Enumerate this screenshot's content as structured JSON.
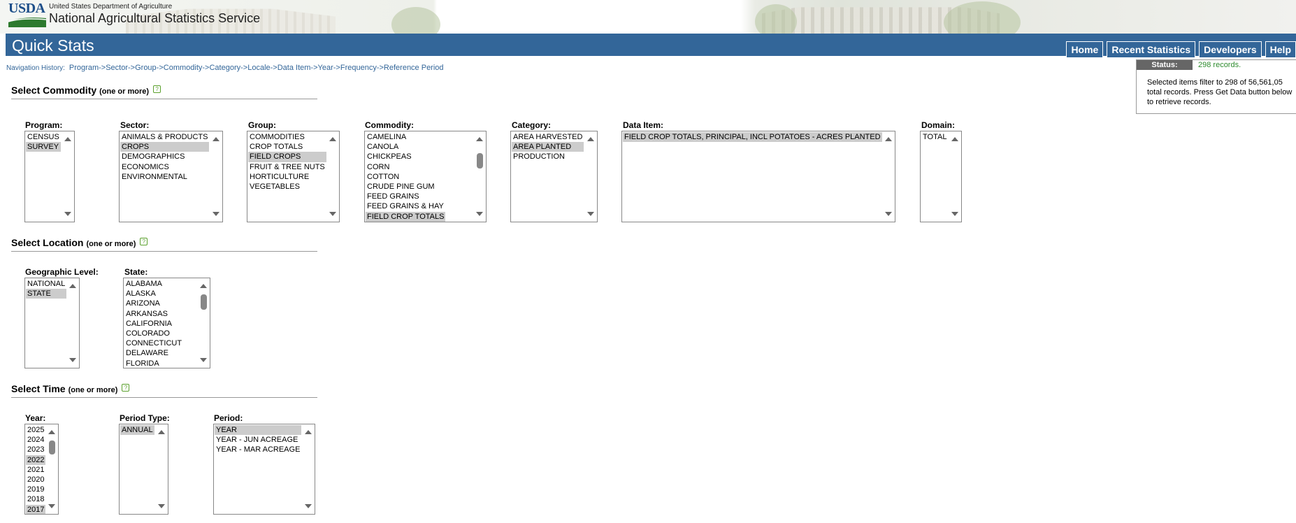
{
  "header": {
    "logo_text": "USDA",
    "department": "United States Department of Agriculture",
    "agency": "National Agricultural Statistics Service"
  },
  "titlebar": {
    "title": "Quick Stats",
    "nav": [
      "Home",
      "Recent Statistics",
      "Developers",
      "Help"
    ]
  },
  "status": {
    "label": "Status:",
    "count": "298 records.",
    "message": "Selected items filter to 298 of 56,561,05 total records. Press Get Data button below to retrieve records."
  },
  "nav_history": {
    "label": "Navigation History:",
    "steps": [
      "Program",
      "Sector",
      "Group",
      "Commodity",
      "Category",
      "Locale",
      "Data Item",
      "Year",
      "Frequency",
      "Reference Period"
    ],
    "separator": "->"
  },
  "commodity_section": {
    "title": "Select Commodity",
    "subtitle": "(one or more)",
    "program": {
      "label": "Program:",
      "options": [
        "CENSUS",
        "SURVEY"
      ],
      "selected": [
        "SURVEY"
      ]
    },
    "sector": {
      "label": "Sector:",
      "options": [
        "ANIMALS & PRODUCTS",
        "CROPS",
        "DEMOGRAPHICS",
        "ECONOMICS",
        "ENVIRONMENTAL"
      ],
      "selected": [
        "CROPS"
      ]
    },
    "group": {
      "label": "Group:",
      "options": [
        "COMMODITIES",
        "CROP TOTALS",
        "FIELD CROPS",
        "FRUIT & TREE NUTS",
        "HORTICULTURE",
        "VEGETABLES"
      ],
      "selected": [
        "FIELD CROPS"
      ]
    },
    "commodity": {
      "label": "Commodity:",
      "options": [
        "CAMELINA",
        "CANOLA",
        "CHICKPEAS",
        "CORN",
        "COTTON",
        "CRUDE PINE GUM",
        "FEED GRAINS",
        "FEED GRAINS & HAY",
        "FIELD CROP TOTALS"
      ],
      "selected": [
        "FIELD CROP TOTALS"
      ]
    },
    "category": {
      "label": "Category:",
      "options": [
        "AREA HARVESTED",
        "AREA PLANTED",
        "PRODUCTION"
      ],
      "selected": [
        "AREA PLANTED"
      ]
    },
    "data_item": {
      "label": "Data Item:",
      "options": [
        "FIELD CROP TOTALS, PRINCIPAL, INCL POTATOES - ACRES PLANTED"
      ],
      "selected": [
        "FIELD CROP TOTALS, PRINCIPAL, INCL POTATOES - ACRES PLANTED"
      ]
    },
    "domain": {
      "label": "Domain:",
      "options": [
        "TOTAL"
      ],
      "selected": []
    }
  },
  "location_section": {
    "title": "Select Location",
    "subtitle": "(one or more)",
    "geo_level": {
      "label": "Geographic Level:",
      "options": [
        "NATIONAL",
        "STATE"
      ],
      "selected": [
        "STATE"
      ]
    },
    "state": {
      "label": "State:",
      "options": [
        "ALABAMA",
        "ALASKA",
        "ARIZONA",
        "ARKANSAS",
        "CALIFORNIA",
        "COLORADO",
        "CONNECTICUT",
        "DELAWARE",
        "FLORIDA"
      ],
      "selected": []
    }
  },
  "time_section": {
    "title": "Select Time",
    "subtitle": "(one or more)",
    "year": {
      "label": "Year:",
      "options": [
        "2025",
        "2024",
        "2023",
        "2022",
        "2021",
        "2020",
        "2019",
        "2018",
        "2017"
      ],
      "selected": [
        "2022",
        "2017"
      ]
    },
    "period_type": {
      "label": "Period Type:",
      "options": [
        "ANNUAL"
      ],
      "selected": [
        "ANNUAL"
      ]
    },
    "period": {
      "label": "Period:",
      "options": [
        "YEAR",
        "YEAR - JUN ACREAGE",
        "YEAR - MAR ACREAGE"
      ],
      "selected": [
        "YEAR"
      ]
    }
  }
}
